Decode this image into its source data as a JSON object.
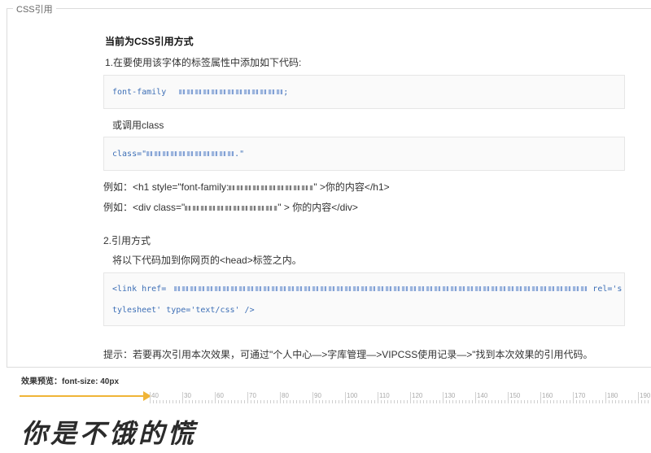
{
  "section": {
    "legend": "CSS引用"
  },
  "heading": "当前为CSS引用方式",
  "step1": {
    "title": "1.在要使用该字体的标签属性中添加如下代码:",
    "code_prefix": "font-family",
    "code_suffix": ";",
    "or_label": "或调用class",
    "class_code": "class=\"",
    "class_code_end": ".\"",
    "example1_prefix": "例如：<h1 style=\"font-family:",
    "example1_suffix": "\" >你的内容</h1>",
    "example2_prefix": "例如：<div class=\"",
    "example2_suffix": "\" > 你的内容</div>"
  },
  "step2": {
    "title": "2.引用方式",
    "desc": "将以下代码加到你网页的<head>标签之内。",
    "link_prefix": "<link href=",
    "link_suffix": "rel='s",
    "link_line2": "tylesheet' type='text/css' />"
  },
  "tip": "提示：若要再次引用本次效果，可通过\"个人中心—>字库管理—>VIPCSS使用记录—>\"找到本次效果的引用代码。",
  "preview": {
    "label": "效果预览：font-size: 40px",
    "ticks": [
      "40",
      "30",
      "60",
      "70",
      "80",
      "90",
      "100",
      "110",
      "120",
      "130",
      "140",
      "150",
      "160",
      "170",
      "180",
      "190"
    ],
    "sample_text": "你是不饿的慌",
    "accent_color": "#f0b437"
  }
}
